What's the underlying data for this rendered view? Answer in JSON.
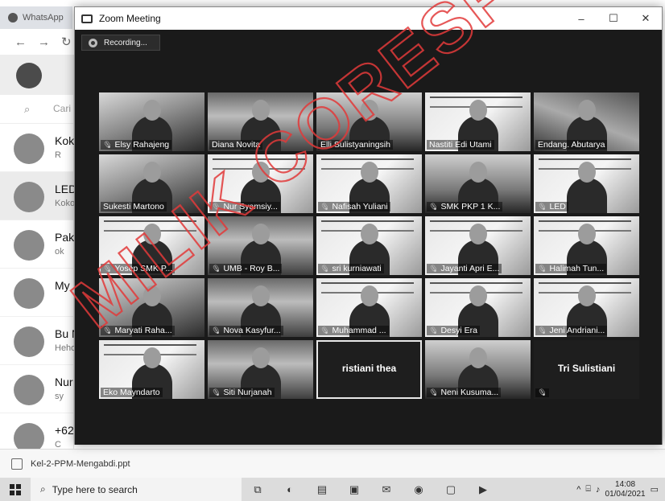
{
  "whatsapp": {
    "tab_label": "WhatsApp",
    "search_placeholder": "Cari",
    "chats": [
      {
        "name": "Kok",
        "preview": "R"
      },
      {
        "name": "LED",
        "preview": "Koko"
      },
      {
        "name": "Pak",
        "preview": "ok"
      },
      {
        "name": "My",
        "preview": ""
      },
      {
        "name": "Bu N",
        "preview": "Heho"
      },
      {
        "name": "Nur",
        "preview": "sy"
      },
      {
        "name": "+62",
        "preview": "C"
      }
    ],
    "download_label": "Kel-2-PPM-Mengabdi.ppt"
  },
  "zoom": {
    "title": "Zoom Meeting",
    "recording_label": "Recording...",
    "controls": {
      "minimize": "–",
      "maximize": "☐",
      "close": "✕"
    },
    "participants": [
      {
        "name": "Elsy Rahajeng",
        "muted": true
      },
      {
        "name": "Diana Novita",
        "muted": false
      },
      {
        "name": "Elli Sulistyaningsih",
        "muted": false
      },
      {
        "name": "Nastiti Edi Utami",
        "muted": false
      },
      {
        "name": "Endang. Abutarya",
        "muted": false
      },
      {
        "name": "Sukesti Martono",
        "muted": false
      },
      {
        "name": "Nur Syamsiy...",
        "muted": true
      },
      {
        "name": "Nafisah Yuliani",
        "muted": true
      },
      {
        "name": "SMK PKP 1 K...",
        "muted": true
      },
      {
        "name": "LED",
        "muted": true
      },
      {
        "name": "Yosep SMK P...",
        "muted": true
      },
      {
        "name": "UMB - Roy B...",
        "muted": true
      },
      {
        "name": "sri kurniawati",
        "muted": true
      },
      {
        "name": "Jayanti Apri E...",
        "muted": true
      },
      {
        "name": "Halimah Tun...",
        "muted": true
      },
      {
        "name": "Maryati Raha...",
        "muted": true
      },
      {
        "name": "Nova Kasyfur...",
        "muted": true
      },
      {
        "name": "Muhammad ...",
        "muted": true
      },
      {
        "name": "Desyi Era",
        "muted": true
      },
      {
        "name": "Jeni Andriani...",
        "muted": true
      },
      {
        "name": "Eko Mayndarto",
        "muted": false
      },
      {
        "name": "Siti Nurjanah",
        "muted": true
      },
      {
        "name": "ristiani thea",
        "muted": false
      },
      {
        "name": "Neni Kusuma...",
        "muted": true
      },
      {
        "name": "Tri Sulistiani",
        "muted": true
      }
    ]
  },
  "watermark": "MILIK CORESPO",
  "taskbar": {
    "search_placeholder": "Type here to search",
    "time": "14:08",
    "date": "01/04/2021"
  }
}
